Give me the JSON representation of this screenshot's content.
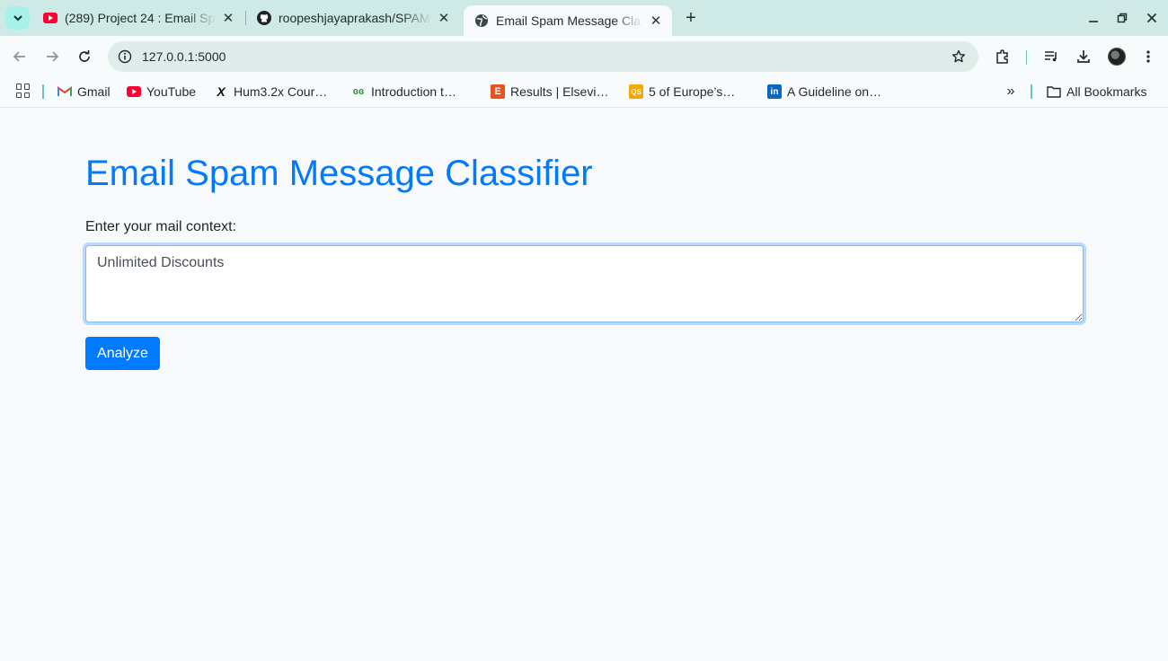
{
  "browser": {
    "tabs": [
      {
        "title": "(289) Project 24 : Email Spam",
        "favicon": "youtube-icon",
        "active": false
      },
      {
        "title": "roopeshjayaprakash/SPAM",
        "favicon": "github-icon",
        "active": false
      },
      {
        "title": "Email Spam Message Classifier",
        "favicon": "globe-icon",
        "active": true
      }
    ],
    "address": "127.0.0.1:5000",
    "bookmarks": [
      {
        "label": "Gmail",
        "icon": "gmail-icon"
      },
      {
        "label": "YouTube",
        "icon": "youtube-icon"
      },
      {
        "label": "Hum3.2x Cour…",
        "icon": "edx-icon"
      },
      {
        "label": "Introduction t…",
        "icon": "geeksforgeeks-icon"
      },
      {
        "label": "Results | Elsevi…",
        "icon": "elsevier-icon"
      },
      {
        "label": "5 of Europe’s…",
        "icon": "qs-icon"
      },
      {
        "label": "A Guideline on…",
        "icon": "linkedin-icon"
      }
    ],
    "all_bookmarks_label": "All Bookmarks",
    "colors": {
      "accent": "#a6f2ea",
      "tabstrip": "#cfe9e6"
    }
  },
  "page": {
    "title": "Email Spam Message Classifier",
    "input_label": "Enter your mail context:",
    "input_value": "Unlimited Discounts",
    "submit_label": "Analyze",
    "colors": {
      "primary": "#007bff",
      "background": "#f8f9fa"
    }
  }
}
